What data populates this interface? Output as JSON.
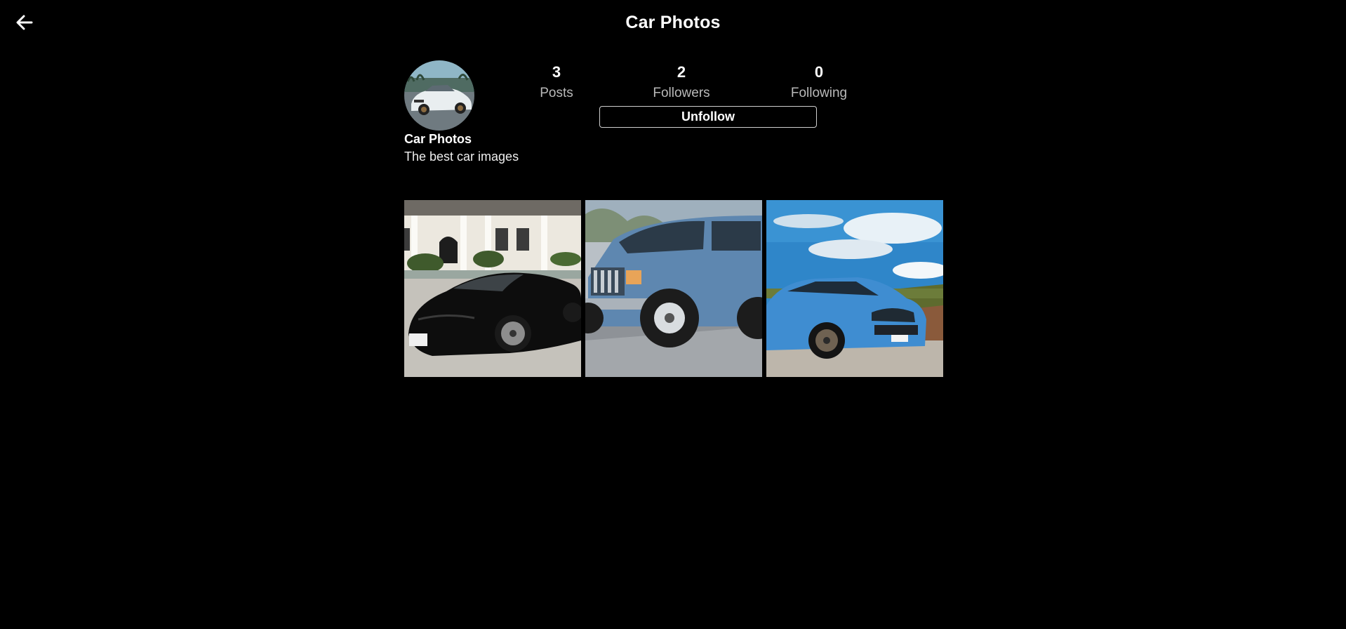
{
  "header": {
    "title": "Car Photos",
    "back_icon": "arrow-left-icon"
  },
  "profile": {
    "name": "Car Photos",
    "bio": "The best car images",
    "stats": {
      "posts": {
        "value": "3",
        "label": "Posts"
      },
      "followers": {
        "value": "2",
        "label": "Followers"
      },
      "following": {
        "value": "0",
        "label": "Following"
      }
    },
    "unfollow_label": "Unfollow"
  },
  "colors": {
    "background": "#000000",
    "text": "#ffffff",
    "muted_text": "#b9b9b9",
    "button_border": "#cfcfcf"
  }
}
